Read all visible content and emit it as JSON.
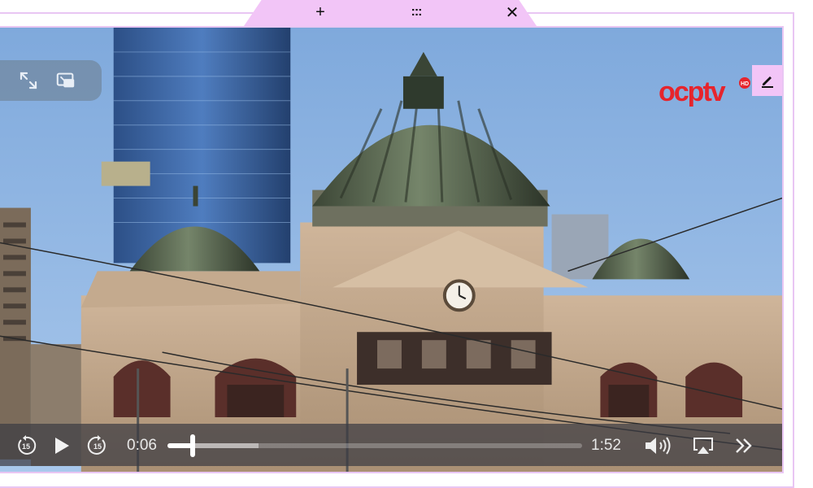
{
  "toolbar": {
    "add_glyph": "+",
    "drag_glyph": ":::",
    "close_glyph": "✕"
  },
  "logo": {
    "text": "ocptv",
    "badge": "HD"
  },
  "player": {
    "current_time": "0:06",
    "duration": "1:52",
    "progress": 0.06,
    "buffered": 0.22,
    "skip_back_seconds": "15",
    "skip_forward_seconds": "15"
  },
  "colors": {
    "accent": "#f2c5f7",
    "frame": "#e9c6f3",
    "sky": "#8bb6e6",
    "logo_red": "#e6242c"
  },
  "icons": [
    "plus-icon",
    "drag-handle-icon",
    "close-icon",
    "fullscreen-icon",
    "pip-icon",
    "edit-icon",
    "skip-back-icon",
    "play-icon",
    "skip-forward-icon",
    "volume-icon",
    "airplay-icon",
    "fast-forward-icon"
  ]
}
